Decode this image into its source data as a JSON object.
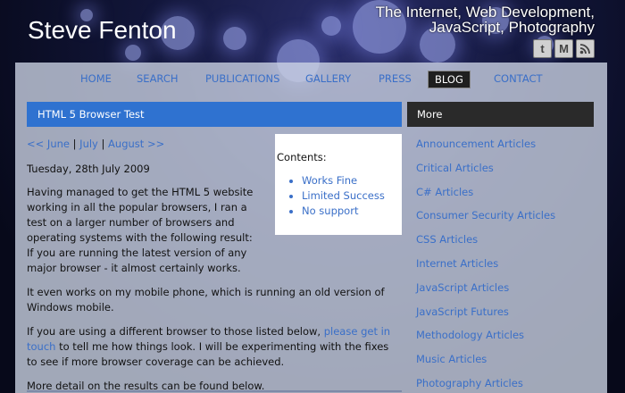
{
  "header": {
    "site_title": "Steve Fenton",
    "tagline": "The Internet, Web Development, JavaScript, Photography",
    "social_icons": [
      "twitter-icon",
      "gmail-icon",
      "rss-icon"
    ]
  },
  "nav": {
    "items": [
      "HOME",
      "SEARCH",
      "PUBLICATIONS",
      "GALLERY",
      "PRESS",
      "BLOG",
      "CONTACT"
    ],
    "active": "BLOG"
  },
  "main": {
    "title": "HTML 5 Browser Test",
    "month_nav": {
      "prev": "<< June",
      "sep1": "|",
      "current": "July",
      "sep2": "|",
      "next": "August >>"
    },
    "date": "Tuesday, 28th July 2009",
    "toc": {
      "title": "Contents:",
      "items": [
        "Works Fine",
        "Limited Success",
        "No support"
      ]
    },
    "paragraphs": {
      "p1": "Having managed to get the HTML 5 website working in all the popular browsers, I ran a test on a larger number of browsers and operating systems with the following result: If you are running the latest version of any major browser - it almost certainly works.",
      "p2": "It even works on my mobile phone, which is running an old version of Windows mobile.",
      "p3_before": "If you are using a different browser to those listed below, ",
      "p3_link": "please get in touch",
      "p3_after": " to tell me how things look. I will be experimenting with the fixes to see if more browser coverage can be achieved.",
      "p4": "More detail on the results can be found below."
    }
  },
  "sidebar": {
    "title": "More",
    "items": [
      "Announcement Articles",
      "Critical Articles",
      "C# Articles",
      "Consumer Security Articles",
      "CSS Articles",
      "Internet Articles",
      "JavaScript Articles",
      "JavaScript Futures",
      "Methodology Articles",
      "Music Articles",
      "Photography Articles"
    ]
  },
  "colors": {
    "accent_blue": "#2f72d0",
    "link": "#3a6fc8",
    "sidebar_header": "#2a2a2a"
  }
}
